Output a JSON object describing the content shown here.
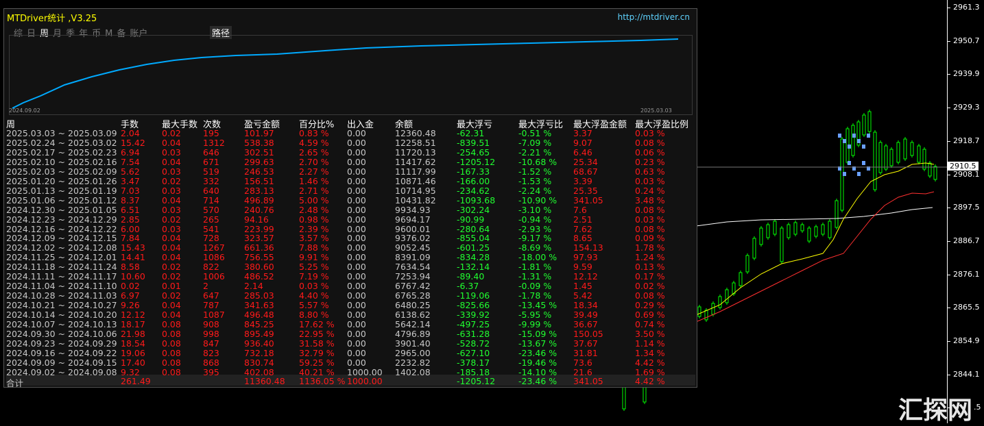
{
  "panel": {
    "title": "MTDriver统计 ,V3.25",
    "url": "http://mtdriver.cn",
    "tabs": [
      "综",
      "日",
      "周",
      "月",
      "季",
      "年",
      "币",
      "M",
      "备",
      "账户"
    ],
    "active_tab": "周",
    "route_btn": "路径",
    "equity_start": "2024.09.02",
    "equity_end": "2025.03.03",
    "headers": [
      "周",
      "手数",
      "最大手数",
      "次数",
      "盈亏金额",
      "百分比%",
      "出入金",
      "余额",
      "最大浮亏",
      "最大浮亏比",
      "最大浮盈金额",
      "最大浮盈比例"
    ],
    "rows": [
      [
        "2025.03.03 ~ 2025.03.09",
        "2.04",
        "0.02",
        "195",
        "101.97",
        "0.83 %",
        "0.00",
        "12360.48",
        "-62.31",
        "-0.51 %",
        "3.37",
        "0.03 %"
      ],
      [
        "2025.02.24 ~ 2025.03.02",
        "15.42",
        "0.04",
        "1312",
        "538.38",
        "4.59 %",
        "0.00",
        "12258.51",
        "-839.51",
        "-7.09 %",
        "9.07",
        "0.08 %"
      ],
      [
        "2025.02.17 ~ 2025.02.23",
        "6.94",
        "0.03",
        "646",
        "302.51",
        "2.65 %",
        "0.00",
        "11720.13",
        "-254.65",
        "-2.21 %",
        "6.46",
        "0.06 %"
      ],
      [
        "2025.02.10 ~ 2025.02.16",
        "7.54",
        "0.04",
        "671",
        "299.63",
        "2.70 %",
        "0.00",
        "11417.62",
        "-1205.12",
        "-10.68 %",
        "25.34",
        "0.23 %"
      ],
      [
        "2025.02.03 ~ 2025.02.09",
        "5.62",
        "0.03",
        "519",
        "246.53",
        "2.27 %",
        "0.00",
        "11117.99",
        "-167.33",
        "-1.52 %",
        "68.67",
        "0.63 %"
      ],
      [
        "2025.01.20 ~ 2025.01.26",
        "3.47",
        "0.02",
        "332",
        "156.51",
        "1.46 %",
        "0.00",
        "10871.46",
        "-166.00",
        "-1.53 %",
        "3.39",
        "0.03 %"
      ],
      [
        "2025.01.13 ~ 2025.01.19",
        "7.03",
        "0.03",
        "640",
        "283.13",
        "2.71 %",
        "0.00",
        "10714.95",
        "-234.62",
        "-2.24 %",
        "25.35",
        "0.24 %"
      ],
      [
        "2025.01.06 ~ 2025.01.12",
        "8.37",
        "0.04",
        "714",
        "496.89",
        "5.00 %",
        "0.00",
        "10431.82",
        "-1093.68",
        "-10.90 %",
        "341.05",
        "3.48 %"
      ],
      [
        "2024.12.30 ~ 2025.01.05",
        "6.51",
        "0.03",
        "570",
        "240.76",
        "2.48 %",
        "0.00",
        "9934.93",
        "-302.24",
        "-3.10 %",
        "7.6",
        "0.08 %"
      ],
      [
        "2024.12.23 ~ 2024.12.29",
        "2.85",
        "0.02",
        "265",
        "94.16",
        "0.98 %",
        "0.00",
        "9694.17",
        "-90.99",
        "-0.94 %",
        "2.51",
        "0.03 %"
      ],
      [
        "2024.12.16 ~ 2024.12.22",
        "6.00",
        "0.03",
        "541",
        "223.99",
        "2.39 %",
        "0.00",
        "9600.01",
        "-280.64",
        "-2.93 %",
        "7.62",
        "0.08 %"
      ],
      [
        "2024.12.09 ~ 2024.12.15",
        "7.84",
        "0.04",
        "728",
        "323.57",
        "3.57 %",
        "0.00",
        "9376.02",
        "-855.04",
        "-9.17 %",
        "8.65",
        "0.09 %"
      ],
      [
        "2024.12.02 ~ 2024.12.08",
        "15.43",
        "0.04",
        "1267",
        "661.36",
        "7.88 %",
        "0.00",
        "9052.45",
        "-601.25",
        "-8.69 %",
        "154.13",
        "1.78 %"
      ],
      [
        "2024.11.25 ~ 2024.12.01",
        "14.41",
        "0.04",
        "1086",
        "756.55",
        "9.91 %",
        "0.00",
        "8391.09",
        "-834.28",
        "-18.00 %",
        "97.93",
        "1.24 %"
      ],
      [
        "2024.11.18 ~ 2024.11.24",
        "8.58",
        "0.02",
        "822",
        "380.60",
        "5.25 %",
        "0.00",
        "7634.54",
        "-132.14",
        "-1.81 %",
        "9.59",
        "0.13 %"
      ],
      [
        "2024.11.11 ~ 2024.11.17",
        "10.60",
        "0.02",
        "1006",
        "486.52",
        "7.19 %",
        "0.00",
        "7253.94",
        "-89.40",
        "-1.31 %",
        "12.12",
        "0.17 %"
      ],
      [
        "2024.11.04 ~ 2024.11.10",
        "0.02",
        "0.01",
        "2",
        "2.14",
        "0.03 %",
        "0.00",
        "6767.42",
        "-6.37",
        "-0.09 %",
        "1.45",
        "0.02 %"
      ],
      [
        "2024.10.28 ~ 2024.11.03",
        "6.97",
        "0.02",
        "647",
        "285.03",
        "4.40 %",
        "0.00",
        "6765.28",
        "-119.06",
        "-1.78 %",
        "5.42",
        "0.08 %"
      ],
      [
        "2024.10.21 ~ 2024.10.27",
        "9.26",
        "0.04",
        "787",
        "341.63",
        "5.57 %",
        "0.00",
        "6480.25",
        "-825.66",
        "-13.45 %",
        "18.34",
        "0.29 %"
      ],
      [
        "2024.10.14 ~ 2024.10.20",
        "12.12",
        "0.04",
        "1087",
        "496.48",
        "8.80 %",
        "0.00",
        "6138.62",
        "-339.92",
        "-5.95 %",
        "39.49",
        "0.69 %"
      ],
      [
        "2024.10.07 ~ 2024.10.13",
        "18.17",
        "0.08",
        "908",
        "845.25",
        "17.62 %",
        "0.00",
        "5642.14",
        "-497.25",
        "-9.99 %",
        "36.67",
        "0.74 %"
      ],
      [
        "2024.09.30 ~ 2024.10.06",
        "21.98",
        "0.08",
        "998",
        "895.49",
        "22.95 %",
        "0.00",
        "4796.89",
        "-631.28",
        "-15.09 %",
        "150.05",
        "3.50 %"
      ],
      [
        "2024.09.23 ~ 2024.09.29",
        "18.54",
        "0.08",
        "847",
        "936.40",
        "31.58 %",
        "0.00",
        "3901.40",
        "-528.72",
        "-13.67 %",
        "37.67",
        "1.14 %"
      ],
      [
        "2024.09.16 ~ 2024.09.22",
        "19.06",
        "0.08",
        "823",
        "732.18",
        "32.79 %",
        "0.00",
        "2965.00",
        "-627.10",
        "-23.46 %",
        "31.81",
        "1.34 %"
      ],
      [
        "2024.09.09 ~ 2024.09.15",
        "17.40",
        "0.08",
        "868",
        "830.74",
        "59.25 %",
        "0.00",
        "2232.82",
        "-378.17",
        "-19.46 %",
        "73.6",
        "4.42 %"
      ],
      [
        "2024.09.02 ~ 2024.09.08",
        "9.32",
        "0.08",
        "395",
        "402.08",
        "40.21 %",
        "1000.00",
        "1402.08",
        "-185.18",
        "-14.10 %",
        "21.6",
        "1.69 %"
      ]
    ],
    "total": {
      "label": "合计",
      "lots": "261.49",
      "pnl": "11360.48",
      "pct": "1136.05 %",
      "deposit": "1000.00",
      "dd": "-1205.12",
      "dd_pct": "-23.46 %",
      "fp": "341.05",
      "fp_pct": "4.42 %"
    }
  },
  "price_axis": {
    "labels": [
      "2961.3",
      "2950.7",
      "2939.9",
      "2929.3",
      "2918.7",
      "2908.1",
      "2897.5",
      "2886.7",
      "2876.1",
      "2865.5",
      "2854.9",
      "2844.1",
      ".5"
    ],
    "current": "2910.5"
  },
  "watermark": "汇探网",
  "colors": {
    "bull": "#00ff00",
    "bear": "#00ff00",
    "ma_fast": "#ffff00",
    "ma_slow": "#ff3030",
    "ma_long": "#ffffff",
    "equity": "#00aaff"
  }
}
